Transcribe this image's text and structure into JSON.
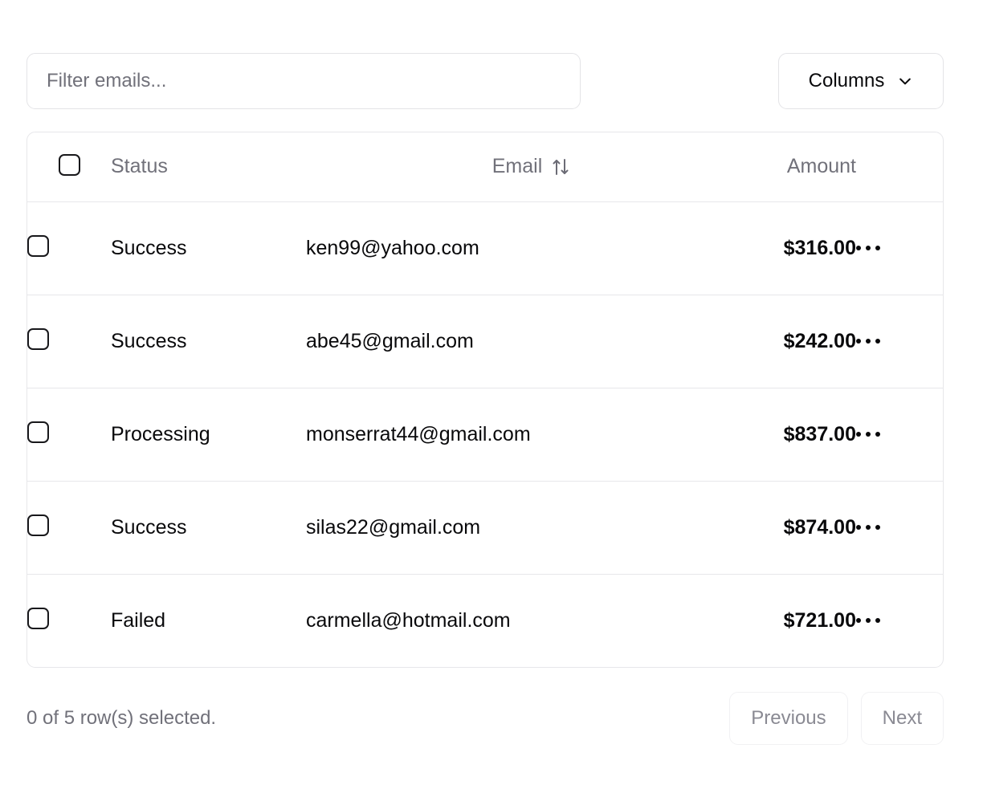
{
  "toolbar": {
    "filter": {
      "placeholder": "Filter emails...",
      "value": ""
    },
    "columns_button": {
      "label": "Columns",
      "icon": "chevron-down-icon"
    }
  },
  "table": {
    "columns": [
      {
        "key": "select",
        "label": ""
      },
      {
        "key": "status",
        "label": "Status"
      },
      {
        "key": "email",
        "label": "Email",
        "sortable": true,
        "sort_icon": "sort-updown-icon"
      },
      {
        "key": "amount",
        "label": "Amount",
        "align": "right"
      },
      {
        "key": "actions",
        "label": ""
      }
    ],
    "rows": [
      {
        "selected": false,
        "status": "Success",
        "email": "ken99@yahoo.com",
        "amount": "$316.00",
        "actions_icon": "ellipsis-horizontal-icon"
      },
      {
        "selected": false,
        "status": "Success",
        "email": "abe45@gmail.com",
        "amount": "$242.00",
        "actions_icon": "ellipsis-horizontal-icon"
      },
      {
        "selected": false,
        "status": "Processing",
        "email": "monserrat44@gmail.com",
        "amount": "$837.00",
        "actions_icon": "ellipsis-horizontal-icon"
      },
      {
        "selected": false,
        "status": "Success",
        "email": "silas22@gmail.com",
        "amount": "$874.00",
        "actions_icon": "ellipsis-horizontal-icon"
      },
      {
        "selected": false,
        "status": "Failed",
        "email": "carmella@hotmail.com",
        "amount": "$721.00",
        "actions_icon": "ellipsis-horizontal-icon"
      }
    ]
  },
  "footer": {
    "selection_summary": "0 of 5 row(s) selected.",
    "previous_label": "Previous",
    "next_label": "Next"
  },
  "colors": {
    "border": "#e7e7eb",
    "muted_text": "#71717a",
    "text": "#09090b",
    "background": "#ffffff"
  }
}
